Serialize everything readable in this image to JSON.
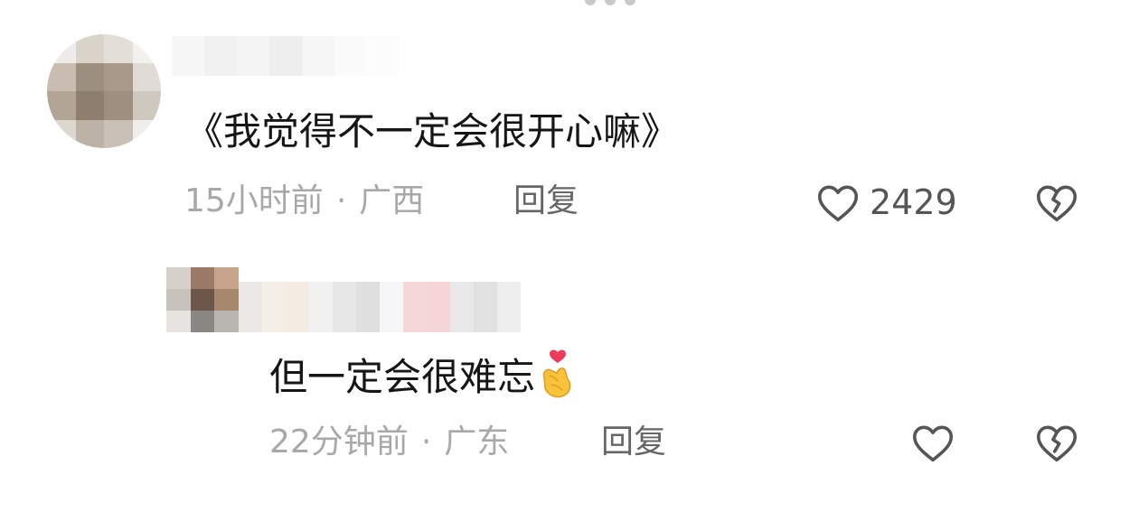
{
  "comments": [
    {
      "text": "《我觉得不一定会很开心嘛》",
      "time": "15小时前",
      "location": "广西",
      "reply_label": "回复",
      "like_count": "2429",
      "avatar_state": "blurred",
      "username_state": "blurred"
    },
    {
      "text": "但一定会很难忘",
      "emoji": "finger-heart-icon",
      "time": "22分钟前",
      "location": "广东",
      "reply_label": "回复",
      "like_count": "",
      "avatar_state": "blurred",
      "username_state": "blurred"
    }
  ],
  "separator": "·",
  "colors": {
    "text": "#161616",
    "meta": "#a8a8a8",
    "action": "#666666",
    "icon": "#555555"
  }
}
